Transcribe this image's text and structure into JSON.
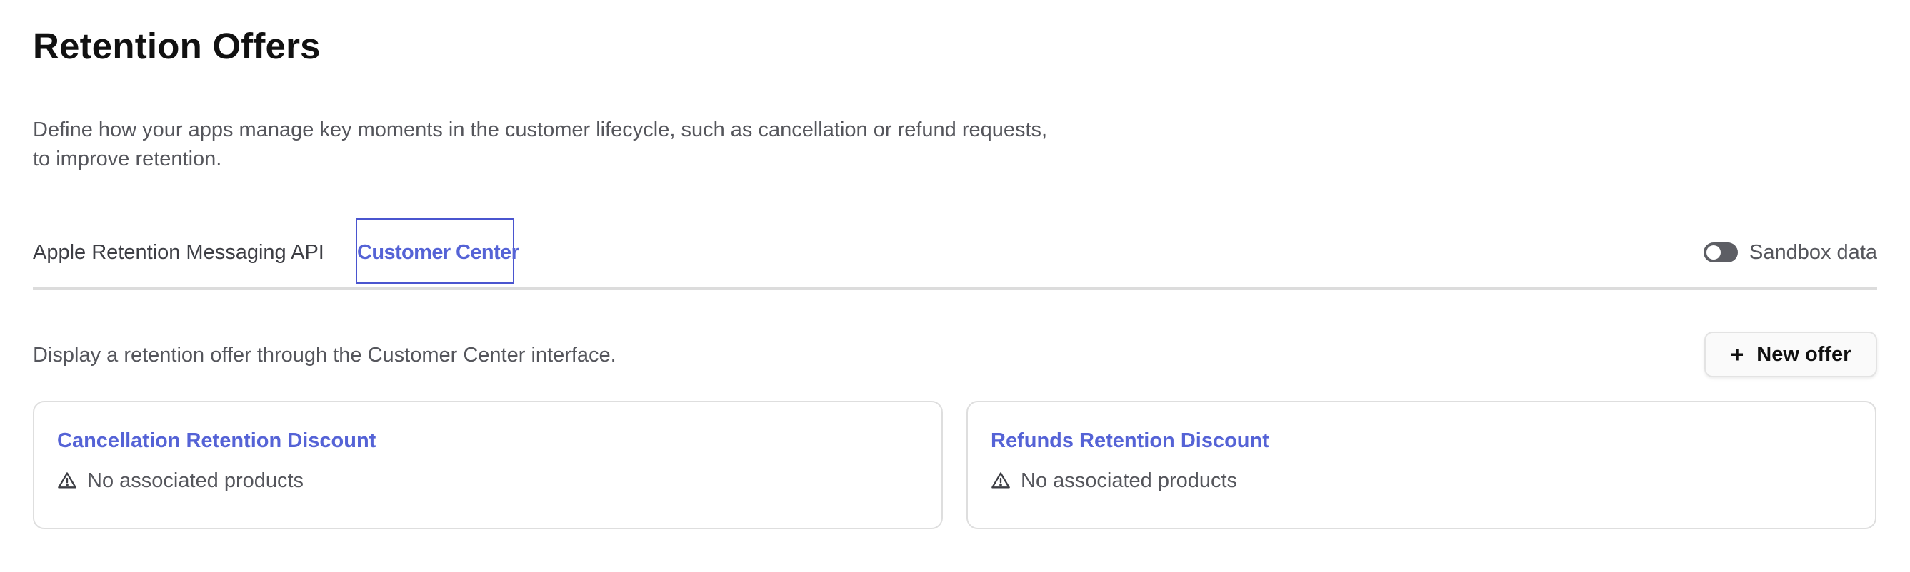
{
  "page": {
    "title": "Retention Offers",
    "description_line1": "Define how your apps manage key moments in the customer lifecycle, such as cancellation or refund requests,",
    "description_line2": "to improve retention."
  },
  "tabs": [
    {
      "label": "Apple Retention Messaging API",
      "active": false
    },
    {
      "label": "Customer Center",
      "active": true
    }
  ],
  "sandbox": {
    "label": "Sandbox data",
    "enabled": false,
    "icon": "toggle-switch"
  },
  "section": {
    "text": "Display a retention offer through the Customer Center interface.",
    "new_offer_label": "New offer",
    "new_offer_icon": "plus-icon"
  },
  "offers": [
    {
      "title": "Cancellation Retention Discount",
      "status": "No associated products",
      "icon": "warning-icon"
    },
    {
      "title": "Refunds Retention Discount",
      "status": "No associated products",
      "icon": "warning-icon"
    }
  ],
  "colors": {
    "accent": "#5563d6",
    "text_muted": "#55565c",
    "border": "#dedede"
  }
}
